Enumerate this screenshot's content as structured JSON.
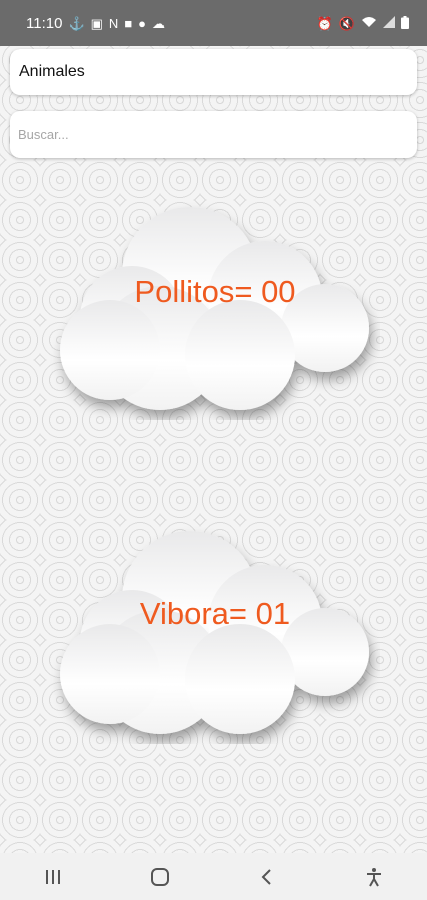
{
  "status_bar": {
    "time": "11:10",
    "left_icons": [
      "usb-icon",
      "image-icon",
      "n-icon",
      "flipboard-icon",
      "whatsapp-icon",
      "cloud-icon"
    ],
    "right_icons": [
      "alarm-icon",
      "mute-icon",
      "wifi-icon",
      "signal-icon",
      "battery-icon"
    ]
  },
  "header": {
    "category_value": "Animales",
    "search_placeholder": "Buscar..."
  },
  "cards": [
    {
      "label": "Pollitos= 00"
    },
    {
      "label": "Vibora= 01"
    }
  ],
  "colors": {
    "label_orange": "#ef5a1f",
    "status_bar_bg": "#6b6b6b"
  },
  "nav_bar": {
    "buttons": [
      "recent-apps-icon",
      "home-icon",
      "back-icon",
      "accessibility-icon"
    ]
  }
}
